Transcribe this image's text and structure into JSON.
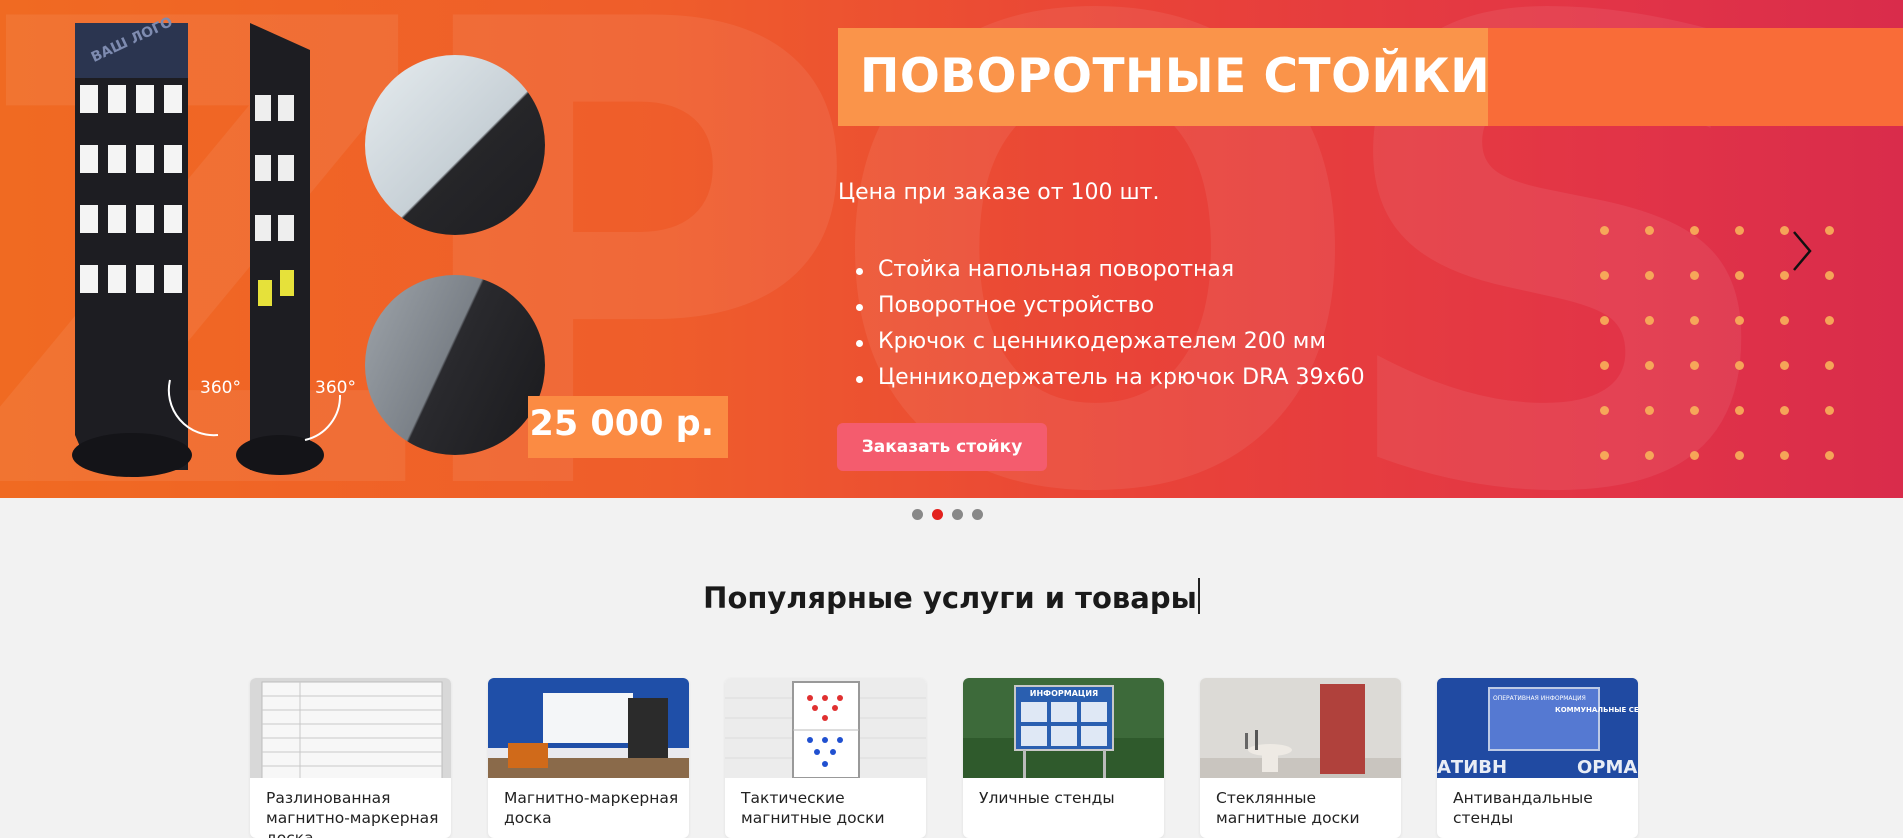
{
  "hero": {
    "title": "ПОВОРОТНЫЕ СТОЙКИ",
    "price_note": "Цена при заказе от 100 шт.",
    "features": [
      "Стойка напольная поворотная",
      "Поворотное устройство",
      "Крючок с ценникодержателем 200 мм",
      "Ценникодержатель на крючок DRA 39х60"
    ],
    "order_button": "Заказать стойку",
    "price": "25 000 р.",
    "logo_placeholder": "ВАШ ЛОГО",
    "rotation_left": "360°",
    "rotation_right": "360°"
  },
  "slider": {
    "slide_count": 4,
    "active_index": 1
  },
  "popular": {
    "title": "Популярные услуги и товары",
    "cards": [
      {
        "label": "Разлинованная магнитно-маркерная доска"
      },
      {
        "label": "Магнитно-маркерная доска"
      },
      {
        "label": "Тактические магнитные доски"
      },
      {
        "label": "Уличные стенды"
      },
      {
        "label": "Стеклянные магнитные доски"
      },
      {
        "label": "Антивандальные стенды"
      }
    ],
    "card_texts": {
      "info_sign": "ИНФОРМАЦИЯ",
      "op_info": "ОПЕРАТИВНАЯ ИНФОРМАЦИЯ",
      "communal": "КОММУНАЛЬНЫЕ СЕТИ",
      "bottom_left": "АТИВН",
      "bottom_right": "ОРМАЦ"
    }
  },
  "colors": {
    "hero_start": "#f06a22",
    "hero_end": "#d92c4b",
    "title_box": "#fa944a",
    "order_button": "#f45c6e",
    "active_dot": "#e3211d"
  }
}
